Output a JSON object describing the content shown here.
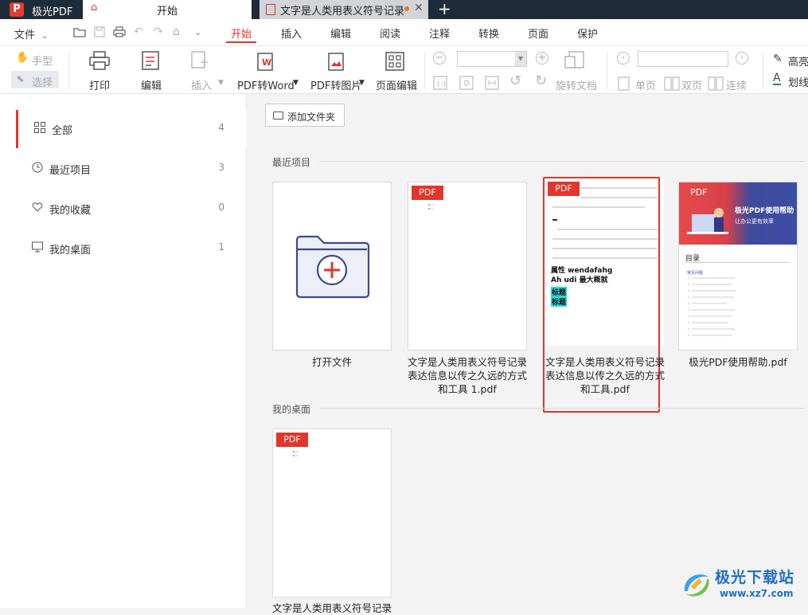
{
  "titlebar": {
    "app_name": "极光PDF",
    "tab_home": "开始",
    "tab_doc": "文字是人类用表义符号记录..."
  },
  "menubar": {
    "file": "文件",
    "tabs": [
      "开始",
      "插入",
      "编辑",
      "阅读",
      "注释",
      "转换",
      "页面",
      "保护"
    ]
  },
  "toolbar": {
    "hand": "手型",
    "select": "选择",
    "print": "打印",
    "edit": "编辑",
    "insert": "插入",
    "pdf_to_word": "PDF转Word",
    "pdf_to_image": "PDF转图片",
    "page_edit": "页面编辑",
    "rotate_doc": "旋转文档",
    "single_page": "单页",
    "double_page": "双页",
    "continuous": "连续",
    "highlight": "高亮",
    "underline": "划线"
  },
  "sidebar": {
    "items": [
      {
        "label": "全部",
        "count": "4"
      },
      {
        "label": "最近项目",
        "count": "3"
      },
      {
        "label": "我的收藏",
        "count": "0"
      },
      {
        "label": "我的桌面",
        "count": "1"
      }
    ]
  },
  "main": {
    "add_folder": "添加文件夹",
    "recent_title": "最近项目",
    "desktop_title": "我的桌面",
    "pdf_tag": "PDF",
    "open_file": "打开文件",
    "files": [
      {
        "line1": "文字是人类用表义符号记录",
        "line2": "表达信息以传之久远的方式",
        "line3": "和工具 1.pdf"
      },
      {
        "line1": "文字是人类用表义符号记录",
        "line2": "表达信息以传之久远的方式",
        "line3": "和工具.pdf"
      },
      {
        "line1": "极光PDF使用帮助.pdf"
      }
    ],
    "desktop_file": "文字是人类用表义符号记录",
    "thumb2": {
      "heading1": "属性 wendafahg",
      "heading2": "Ah udi 最大概就",
      "tag1": "标题",
      "tag2": "标题"
    },
    "thumb3": {
      "title": "极光PDF使用帮助",
      "subtitle": "让办公更有效率",
      "toc": "目录",
      "faq": "常见问题"
    }
  },
  "watermark": {
    "text": "极光下载站",
    "url": "www.xz7.com"
  }
}
